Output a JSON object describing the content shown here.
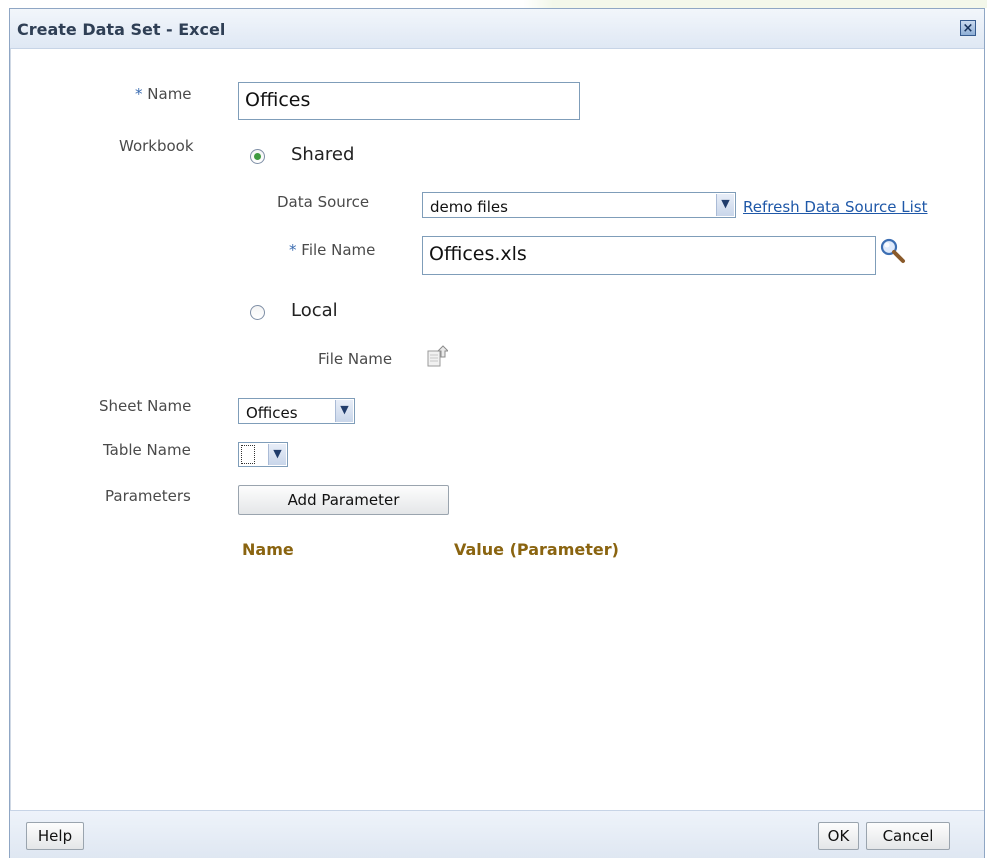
{
  "dialog": {
    "title": "Create Data Set - Excel",
    "close_icon": "close-icon"
  },
  "form": {
    "name_required_mark": "*",
    "name_label": "Name",
    "name_value": "Offices",
    "workbook_label": "Workbook",
    "shared_label": "Shared",
    "shared_selected": true,
    "data_source_label": "Data Source",
    "data_source_value": "demo files",
    "refresh_link": "Refresh Data Source List",
    "file_name_required_mark": "*",
    "file_name_label": "File Name",
    "file_name_value": "Offices.xls",
    "search_icon": "search-icon",
    "local_label": "Local",
    "local_selected": false,
    "local_file_name_label": "File Name",
    "upload_icon": "upload-icon",
    "sheet_name_label": "Sheet Name",
    "sheet_name_value": "Offices",
    "table_name_label": "Table Name",
    "table_name_value": "",
    "parameters_label": "Parameters",
    "add_parameter_button": "Add Parameter",
    "columns": [
      "Name",
      "Value (Parameter)"
    ]
  },
  "footer": {
    "help_button": "Help",
    "ok_button": "OK",
    "cancel_button": "Cancel"
  },
  "colors": {
    "title_text": "#2f3f55",
    "label_text": "#4a4a4a",
    "column_header": "#8a6410",
    "link": "#1f58a8",
    "radio_selected": "#3f9a3f"
  }
}
